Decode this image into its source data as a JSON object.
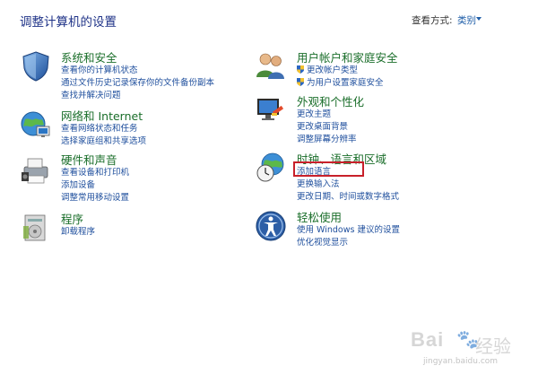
{
  "header": {
    "title": "调整计算机的设置",
    "view_by_label": "查看方式:",
    "view_by_value": "类别"
  },
  "categories": {
    "system_security": {
      "title": "系统和安全",
      "links": [
        "查看你的计算机状态",
        "通过文件历史记录保存你的文件备份副本",
        "查找并解决问题"
      ]
    },
    "network": {
      "title": "网络和 Internet",
      "links": [
        "查看网络状态和任务",
        "选择家庭组和共享选项"
      ]
    },
    "hardware": {
      "title": "硬件和声音",
      "links": [
        "查看设备和打印机",
        "添加设备",
        "调整常用移动设置"
      ]
    },
    "programs": {
      "title": "程序",
      "links": [
        "卸载程序"
      ]
    },
    "user_accounts": {
      "title": "用户帐户和家庭安全",
      "links": [
        "更改帐户类型",
        "为用户设置家庭安全"
      ]
    },
    "appearance": {
      "title": "外观和个性化",
      "links": [
        "更改主题",
        "更改桌面背景",
        "调整屏幕分辨率"
      ]
    },
    "clock_region": {
      "title": "时钟、语言和区域",
      "links": [
        "添加语言",
        "更换输入法",
        "更改日期、时间或数字格式"
      ]
    },
    "ease_of_access": {
      "title": "轻松使用",
      "links": [
        "使用 Windows 建议的设置",
        "优化视觉显示"
      ]
    }
  },
  "watermark": {
    "logo": "Bai",
    "brand_cn": "经验",
    "url": "jingyan.baidu.com"
  },
  "colors": {
    "title": "#1e3287",
    "category_title": "#1a6e2a",
    "link": "#1f4f9d",
    "highlight": "#c8202a"
  }
}
